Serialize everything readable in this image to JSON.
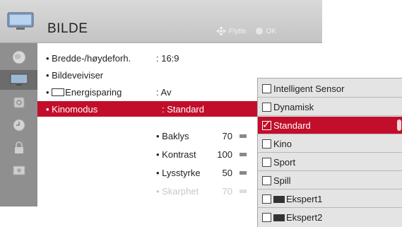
{
  "header": {
    "title": "BILDE",
    "hint_move": "Flytte",
    "hint_ok": "OK",
    "icon": "tv-icon"
  },
  "sidebar": {
    "icons": [
      "globe-icon",
      "picture-icon",
      "speaker-icon",
      "clock-icon",
      "lock-icon",
      "option-icon"
    ],
    "active_index": 1
  },
  "menu": {
    "items": [
      {
        "label": "• Bredde-/høydeforh.",
        "value": ": 16:9"
      },
      {
        "label": "• Bildeveiviser",
        "value": ""
      },
      {
        "label": "Energisparing",
        "value": ": Av",
        "prefix": "• "
      },
      {
        "label": "• Kinomodus",
        "value": ": Standard"
      }
    ],
    "sub_items": [
      {
        "label": "• Baklys",
        "value": "70"
      },
      {
        "label": "• Kontrast",
        "value": "100"
      },
      {
        "label": "• Lysstyrke",
        "value": "50"
      },
      {
        "label": "• Skarphet",
        "value": "70"
      }
    ]
  },
  "dropdown": {
    "options": [
      {
        "label": "Intelligent Sensor",
        "checked": false
      },
      {
        "label": "Dynamisk",
        "checked": false
      },
      {
        "label": "Standard",
        "checked": true
      },
      {
        "label": "Kino",
        "checked": false
      },
      {
        "label": "Sport",
        "checked": false
      },
      {
        "label": "Spill",
        "checked": false
      },
      {
        "label": "Ekspert1",
        "checked": false,
        "badge": "expert-icon"
      },
      {
        "label": "Ekspert2",
        "checked": false,
        "badge": "expert-icon"
      }
    ]
  },
  "colors": {
    "accent": "#c20e2a",
    "sidebar": "#8f8f8f"
  }
}
